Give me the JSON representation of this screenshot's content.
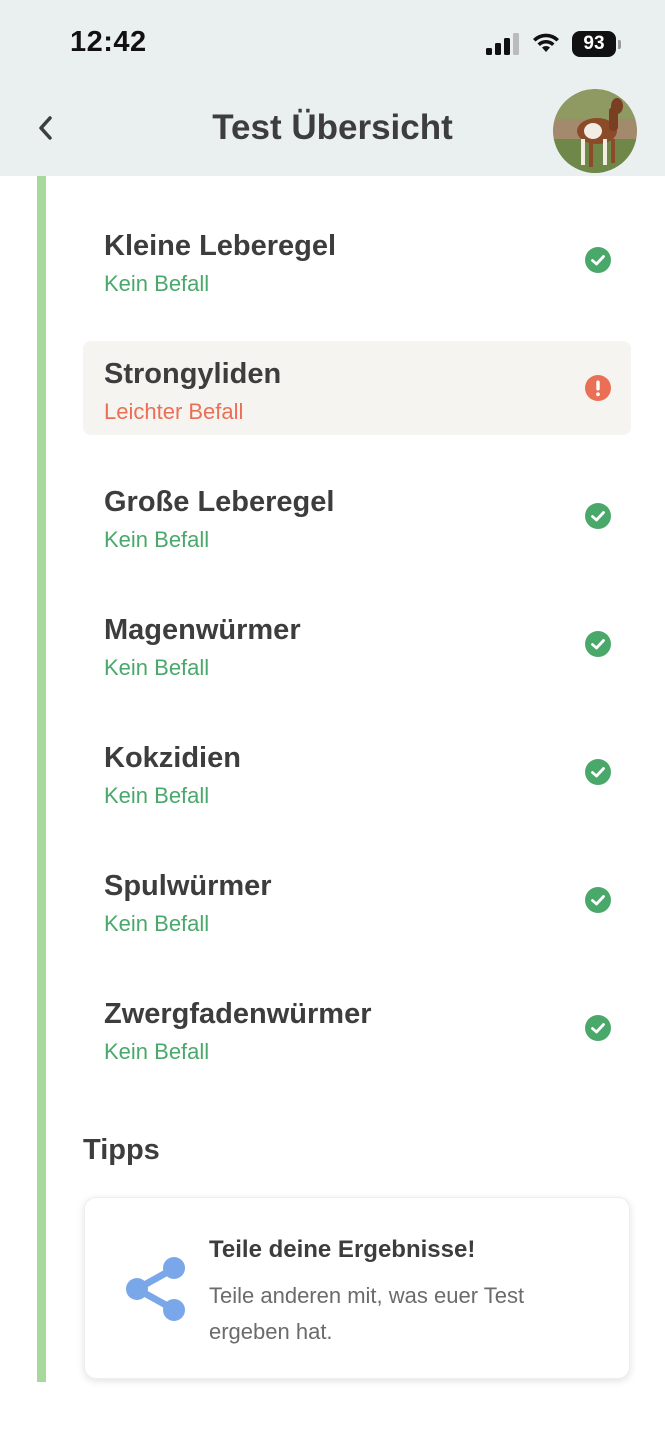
{
  "status_bar": {
    "time": "12:42",
    "battery": "93"
  },
  "header": {
    "title": "Test Übersicht"
  },
  "results": [
    {
      "name": "Kleine Leberegel",
      "status": "Kein Befall",
      "state": "ok"
    },
    {
      "name": "Strongyliden",
      "status": "Leichter Befall",
      "state": "warning"
    },
    {
      "name": "Große Leberegel",
      "status": "Kein Befall",
      "state": "ok"
    },
    {
      "name": "Magenwürmer",
      "status": "Kein Befall",
      "state": "ok"
    },
    {
      "name": "Kokzidien",
      "status": "Kein Befall",
      "state": "ok"
    },
    {
      "name": "Spulwürmer",
      "status": "Kein Befall",
      "state": "ok"
    },
    {
      "name": "Zwergfadenwürmer",
      "status": "Kein Befall",
      "state": "ok"
    }
  ],
  "tips": {
    "heading": "Tipps",
    "card": {
      "title": "Teile deine Ergebnisse!",
      "text": "Teile anderen mit, was euer Test ergeben hat."
    }
  },
  "colors": {
    "ok": "#4aa86a",
    "warning": "#ea6f55",
    "accent_bar": "#a8d89c",
    "share_icon": "#7aa7ea"
  }
}
